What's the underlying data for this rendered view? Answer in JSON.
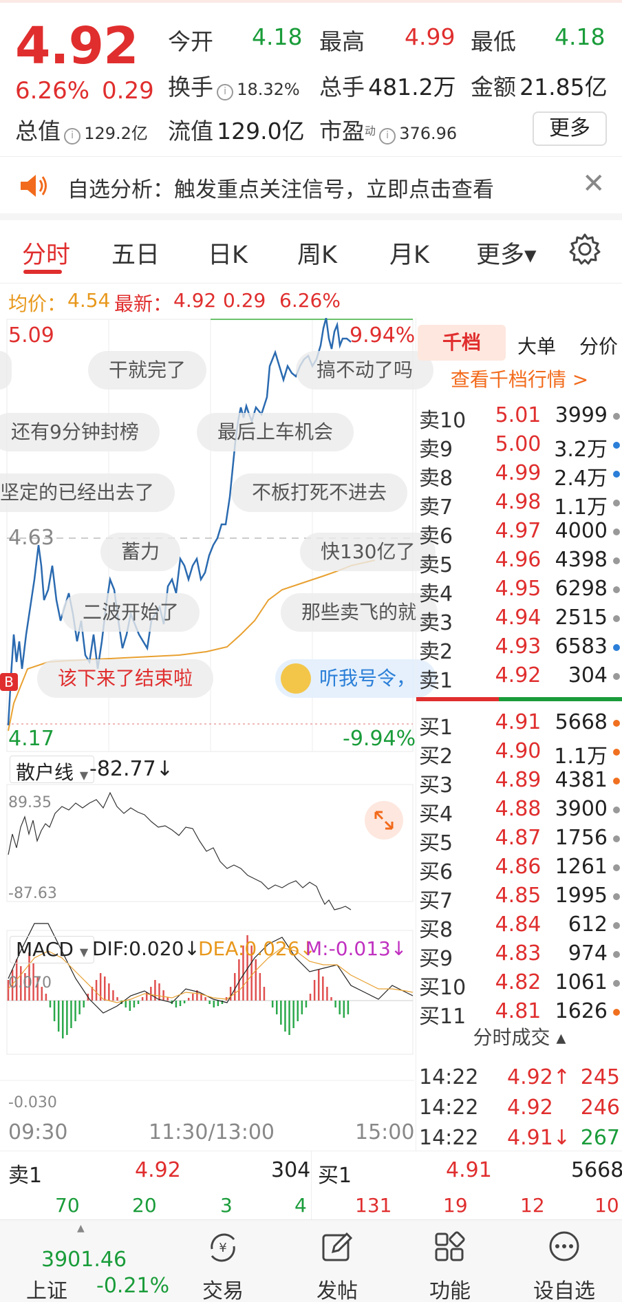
{
  "quote": {
    "price": "4.92",
    "change_pct": "6.26%",
    "change_amt": "0.29",
    "open_label": "今开",
    "open": "4.18",
    "high_label": "最高",
    "high": "4.99",
    "low_label": "最低",
    "low": "4.18",
    "turnover_label": "换手",
    "turnover": "18.32%",
    "volume_label": "总手",
    "volume": "481.2万",
    "amount_label": "金额",
    "amount": "21.85亿",
    "mcap_label": "总值",
    "mcap": "129.2亿",
    "float_label": "流值",
    "float": "129.0亿",
    "pe_label": "市盈",
    "pe_sup": "动",
    "pe": "376.96",
    "more_label": "更多"
  },
  "notice": {
    "text": "自选分析：触发重点关注信号，立即点击查看"
  },
  "tabs": [
    {
      "label": "分时",
      "active": true
    },
    {
      "label": "五日"
    },
    {
      "label": "日K"
    },
    {
      "label": "周K"
    },
    {
      "label": "月K"
    },
    {
      "label": "更多▾"
    }
  ],
  "avgline": {
    "avg_label": "均价：",
    "avg": "4.54",
    "latest_label": "最新：",
    "latest": "4.92",
    "latest_chg": "0.29",
    "latest_pct": "6.26%"
  },
  "chart": {
    "ymax": "5.09",
    "ymax_pct": "9.94%",
    "ymin": "4.17",
    "ymin_pct": "-9.94%",
    "ymid": "4.63",
    "time_start": "09:30",
    "time_mid": "11:30/13:00",
    "time_end": "15:00",
    "b_marker": "B",
    "bubbles": [
      "干就完了",
      "搞不动了吗",
      "还有9分钟封榜",
      "最后上车机会",
      "坚定的已经出去了",
      "不板打死不进去",
      "蓄力",
      "快130亿了",
      "二波开始了",
      "那些卖飞的就",
      "该下来了结束啦",
      "听我号令，"
    ]
  },
  "retail": {
    "label": "散户线",
    "value": "-82.77↓",
    "max": "89.35",
    "min": "-87.63"
  },
  "macd": {
    "label": "MACD",
    "dif": "DIF:0.020↓",
    "dea": "DEA:0.026↓",
    "m": "M:-0.013↓",
    "max": "0.070",
    "min": "-0.030"
  },
  "right_tabs": [
    {
      "label": "千档",
      "active": true
    },
    {
      "label": "大单"
    },
    {
      "label": "分价"
    }
  ],
  "thousand_link": "查看千档行情 >",
  "asks": [
    {
      "l": "卖10",
      "p": "5.01",
      "v": "3999",
      "dot": "#999"
    },
    {
      "l": "卖9",
      "p": "5.00",
      "v": "3.2万",
      "dot": "#2b7fd8"
    },
    {
      "l": "卖8",
      "p": "4.99",
      "v": "2.4万",
      "dot": "#2b7fd8"
    },
    {
      "l": "卖7",
      "p": "4.98",
      "v": "1.1万",
      "dot": "#999"
    },
    {
      "l": "卖6",
      "p": "4.97",
      "v": "4000",
      "dot": "#999"
    },
    {
      "l": "卖5",
      "p": "4.96",
      "v": "4398",
      "dot": "#999"
    },
    {
      "l": "卖4",
      "p": "4.95",
      "v": "6298",
      "dot": "#999"
    },
    {
      "l": "卖3",
      "p": "4.94",
      "v": "2515",
      "dot": "#999"
    },
    {
      "l": "卖2",
      "p": "4.93",
      "v": "6583",
      "dot": "#2b7fd8"
    },
    {
      "l": "卖1",
      "p": "4.92",
      "v": "304",
      "dot": "#999"
    }
  ],
  "bids": [
    {
      "l": "买1",
      "p": "4.91",
      "v": "5668",
      "dot": "#f07020"
    },
    {
      "l": "买2",
      "p": "4.90",
      "v": "1.1万",
      "dot": "#f07020"
    },
    {
      "l": "买3",
      "p": "4.89",
      "v": "4381",
      "dot": "#f07020"
    },
    {
      "l": "买4",
      "p": "4.88",
      "v": "3900",
      "dot": "#999"
    },
    {
      "l": "买5",
      "p": "4.87",
      "v": "1756",
      "dot": "#999"
    },
    {
      "l": "买6",
      "p": "4.86",
      "v": "1261",
      "dot": "#999"
    },
    {
      "l": "买7",
      "p": "4.85",
      "v": "1995",
      "dot": "#999"
    },
    {
      "l": "买8",
      "p": "4.84",
      "v": "612",
      "dot": "#999"
    },
    {
      "l": "买9",
      "p": "4.83",
      "v": "974",
      "dot": "#999"
    },
    {
      "l": "买10",
      "p": "4.82",
      "v": "1061",
      "dot": "#999"
    },
    {
      "l": "买11",
      "p": "4.81",
      "v": "1626",
      "dot": "#f07020"
    }
  ],
  "ticks_header": "分时成交 ▴",
  "ticks": [
    {
      "t": "14:22",
      "p": "4.92↑",
      "v": "245",
      "pc": "red",
      "vc": "red"
    },
    {
      "t": "14:22",
      "p": "4.92",
      "v": "246",
      "pc": "red",
      "vc": "red"
    },
    {
      "t": "14:22",
      "p": "4.91↓",
      "v": "267",
      "pc": "red",
      "vc": "green"
    }
  ],
  "summary": {
    "sell_label": "卖1",
    "sell_price": "4.92",
    "sell_vol": "304",
    "buy_label": "买1",
    "buy_price": "4.91",
    "buy_vol": "5668",
    "left_nums": [
      "70",
      "20",
      "3",
      "4"
    ],
    "right_nums": [
      "131",
      "19",
      "12",
      "10"
    ]
  },
  "nav": {
    "index_value": "3901.46",
    "index_name": "上证",
    "index_chg": "-0.21%",
    "items": [
      "交易",
      "发帖",
      "功能",
      "设自选"
    ]
  },
  "colors": {
    "up": "#e02e2e",
    "down": "#1a9c3a",
    "avg": "#e8981c",
    "price_line": "#2a6ab0"
  }
}
